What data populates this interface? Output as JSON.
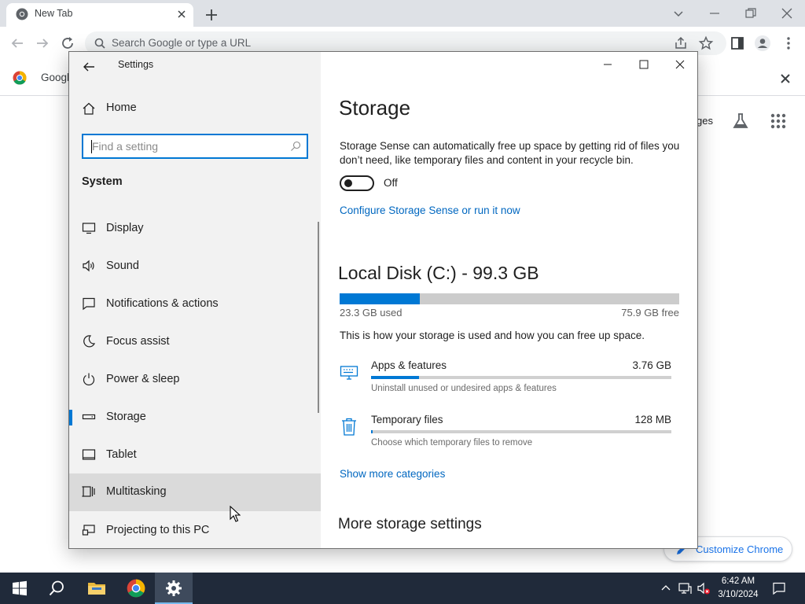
{
  "chrome": {
    "tab_title": "New Tab",
    "omnibox_placeholder": "Search Google or type a URL",
    "bookmark_text": "Googl",
    "ntp_images": "ges",
    "customize_label": "Customize Chrome"
  },
  "settings": {
    "app_title": "Settings",
    "home_label": "Home",
    "find_placeholder": "Find a setting",
    "section_header": "System",
    "nav_items": [
      {
        "label": "Display",
        "icon": "display-icon"
      },
      {
        "label": "Sound",
        "icon": "sound-icon"
      },
      {
        "label": "Notifications & actions",
        "icon": "notifications-icon"
      },
      {
        "label": "Focus assist",
        "icon": "focus-assist-icon"
      },
      {
        "label": "Power & sleep",
        "icon": "power-icon"
      },
      {
        "label": "Storage",
        "icon": "storage-icon",
        "active": true
      },
      {
        "label": "Tablet",
        "icon": "tablet-icon"
      },
      {
        "label": "Multitasking",
        "icon": "multitasking-icon",
        "hover": true
      },
      {
        "label": "Projecting to this PC",
        "icon": "projecting-icon"
      }
    ],
    "main": {
      "title": "Storage",
      "description": "Storage Sense can automatically free up space by getting rid of files you don’t need, like temporary files and content in your recycle bin.",
      "toggle_state": "Off",
      "configure_link": "Configure Storage Sense or run it now",
      "disk_title": "Local Disk (C:) - 99.3 GB",
      "disk_used_fraction": 0.235,
      "used_label": "23.3 GB used",
      "free_label": "75.9 GB free",
      "how_label": "This is how your storage is used and how you can free up space.",
      "categories": [
        {
          "name": "Apps & features",
          "size": "3.76 GB",
          "sub": "Uninstall unused or undesired apps & features",
          "icon": "apps-icon",
          "fraction": 0.16
        },
        {
          "name": "Temporary files",
          "size": "128 MB",
          "sub": "Choose which temporary files to remove",
          "icon": "trash-icon",
          "fraction": 0.005
        }
      ],
      "show_more_link": "Show more categories",
      "more_title": "More storage settings"
    }
  },
  "taskbar": {
    "time": "6:42 AM",
    "date": "3/10/2024"
  },
  "colors": {
    "accent": "#0078d4",
    "link": "#0067c0",
    "taskbar": "#202a3a"
  }
}
